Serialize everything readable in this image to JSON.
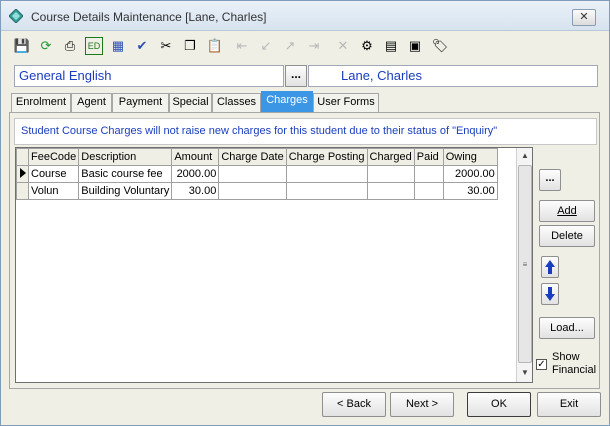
{
  "window": {
    "title": "Course Details Maintenance  [Lane, Charles]",
    "close_label": "✕"
  },
  "toolbar": {
    "buttons": [
      {
        "name": "save-icon",
        "glyph": "💾",
        "enabled": false
      },
      {
        "name": "refresh-icon",
        "glyph": "⟳",
        "enabled": true
      },
      {
        "name": "print-icon",
        "glyph": "⎙",
        "enabled": true
      },
      {
        "name": "edit-icon",
        "glyph": "ED",
        "enabled": true
      },
      {
        "name": "calculator-icon",
        "glyph": "▦",
        "enabled": true
      },
      {
        "name": "spellcheck-icon",
        "glyph": "✔",
        "enabled": true
      },
      {
        "name": "cut-icon",
        "glyph": "✂",
        "enabled": true
      },
      {
        "name": "copy-icon",
        "glyph": "❐",
        "enabled": true
      },
      {
        "name": "paste-icon",
        "glyph": "📋",
        "enabled": true
      },
      {
        "name": "first-icon",
        "glyph": "⇤",
        "enabled": false
      },
      {
        "name": "prev-icon",
        "glyph": "↙",
        "enabled": false
      },
      {
        "name": "next-icon",
        "glyph": "↗",
        "enabled": false
      },
      {
        "name": "last-icon",
        "glyph": "⇥",
        "enabled": false
      },
      {
        "name": "delete-icon",
        "glyph": "✕",
        "enabled": false
      },
      {
        "name": "settings-icon",
        "glyph": "⚙",
        "enabled": true
      },
      {
        "name": "export-icon",
        "glyph": "▤",
        "enabled": true
      },
      {
        "name": "stamp-icon",
        "glyph": "▣",
        "enabled": true
      },
      {
        "name": "tag-icon",
        "glyph": "🏷",
        "enabled": true
      }
    ]
  },
  "course": {
    "name": "General English",
    "lookup_label": "...",
    "student": "Lane, Charles"
  },
  "tabs": [
    {
      "label": "Enrolment",
      "active": false
    },
    {
      "label": "Agent",
      "active": false
    },
    {
      "label": "Payment",
      "active": false
    },
    {
      "label": "Special",
      "active": false
    },
    {
      "label": "Classes",
      "active": false
    },
    {
      "label": "Charges",
      "active": true
    },
    {
      "label": "User Forms",
      "active": false
    }
  ],
  "charges": {
    "notice": "Student Course Charges will not raise new charges for this student due to their status of \"Enquiry\"",
    "columns": [
      "FeeCode",
      "Description",
      "Amount",
      "Charge Date",
      "Charge Posting",
      "Charged",
      "Paid",
      "Owing"
    ],
    "rows": [
      {
        "FeeCode": "Course",
        "Description": "Basic course fee",
        "Amount": "2000.00",
        "Charge Date": "",
        "Charge Posting": "",
        "Charged": "",
        "Paid": "",
        "Owing": "2000.00",
        "current": true
      },
      {
        "FeeCode": "Volun",
        "Description": "Building Voluntary",
        "Amount": "30.00",
        "Charge Date": "",
        "Charge Posting": "",
        "Charged": "",
        "Paid": "",
        "Owing": "30.00",
        "current": false
      }
    ],
    "side": {
      "more_label": "...",
      "add_label": "Add",
      "delete_label": "Delete",
      "load_label": "Load...",
      "show_financial_label": "Show\nFinancial",
      "show_financial_checked": true
    }
  },
  "footer": {
    "back_label": "< Back",
    "next_label": "Next >",
    "ok_label": "OK",
    "exit_label": "Exit"
  }
}
